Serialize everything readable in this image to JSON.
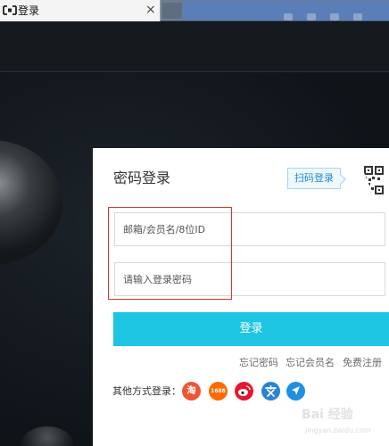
{
  "browser": {
    "tab_title": "登录"
  },
  "login": {
    "title": "密码登录",
    "qr_tip": "扫码登录",
    "account_placeholder": "邮箱/会员名/8位ID",
    "password_placeholder": "请输入登录密码",
    "submit_label": "登录",
    "links": {
      "forgot_password": "忘记密码",
      "forgot_member_name": "忘记会员名",
      "register": "免费注册"
    },
    "other_methods_label": "其他方式登录：",
    "social": [
      {
        "name": "taobao",
        "label": "淘"
      },
      {
        "name": "1688",
        "label": "1688"
      },
      {
        "name": "weibo",
        "label": ""
      },
      {
        "name": "aliwangwang",
        "label": ""
      },
      {
        "name": "alipay",
        "label": ""
      }
    ]
  },
  "colors": {
    "accent": "#1ec5e3",
    "highlight": "#d9372b",
    "page_bg": "#0e1318"
  },
  "watermark": {
    "text": "Bai 经验",
    "sub": "jingyan.baidu.com"
  }
}
